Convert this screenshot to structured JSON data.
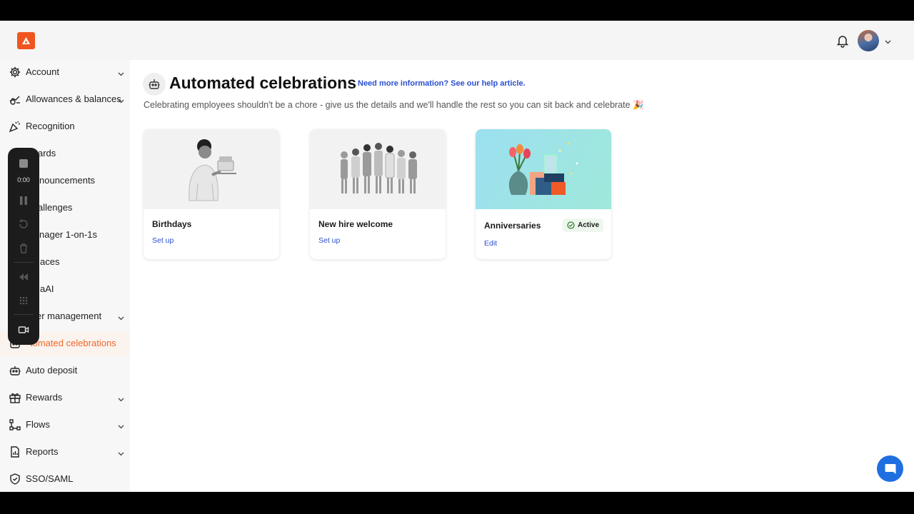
{
  "topbar": {
    "logo_icon": "brand-logo-icon",
    "bell_icon": "bell-icon",
    "avatar_icon": "user-avatar"
  },
  "sidebar": {
    "items": [
      {
        "label": "Account",
        "icon": "gear-icon",
        "has_chevron": true
      },
      {
        "label": "Allowances & balances",
        "icon": "coins-icon",
        "has_chevron": true
      },
      {
        "label": "Recognition",
        "icon": "party-popper-icon",
        "has_chevron": false
      },
      {
        "label": "ards",
        "icon": "award-icon",
        "has_chevron": false
      },
      {
        "label": "nouncements",
        "icon": "megaphone-icon",
        "has_chevron": false
      },
      {
        "label": "allenges",
        "icon": "trophy-icon",
        "has_chevron": false
      },
      {
        "label": "nager 1-on-1s",
        "icon": "people-icon",
        "has_chevron": false
      },
      {
        "label": "aces",
        "icon": "pin-icon",
        "has_chevron": false
      },
      {
        "label": "aAI",
        "icon": "sparkle-icon",
        "has_chevron": false
      },
      {
        "label": "er management",
        "icon": "users-icon",
        "has_chevron": true
      },
      {
        "label": "tomated celebrations",
        "icon": "robot-icon",
        "has_chevron": false,
        "active": true
      },
      {
        "label": "Auto deposit",
        "icon": "robot-icon",
        "has_chevron": false
      },
      {
        "label": "Rewards",
        "icon": "gift-icon",
        "has_chevron": true
      },
      {
        "label": "Flows",
        "icon": "flow-icon",
        "has_chevron": true
      },
      {
        "label": "Reports",
        "icon": "report-icon",
        "has_chevron": true
      },
      {
        "label": "SSO/SAML",
        "icon": "shield-icon",
        "has_chevron": false
      }
    ]
  },
  "recorder": {
    "time": "0:00"
  },
  "main": {
    "title": "Automated celebrations",
    "help_link": "Need more information? See our help article.",
    "subtitle": "Celebrating employees shouldn't be a chore - give us the details and we'll handle the rest so you can sit back and celebrate 🎉",
    "cards": [
      {
        "name": "Birthdays",
        "action": "Set up"
      },
      {
        "name": "New hire welcome",
        "action": "Set up"
      },
      {
        "name": "Anniversaries",
        "action": "Edit",
        "badge": "Active"
      }
    ]
  },
  "colors": {
    "accent": "#ef6a2c",
    "link": "#2a4fcf",
    "brand": "#f0551f",
    "chat": "#1f6fe0"
  }
}
